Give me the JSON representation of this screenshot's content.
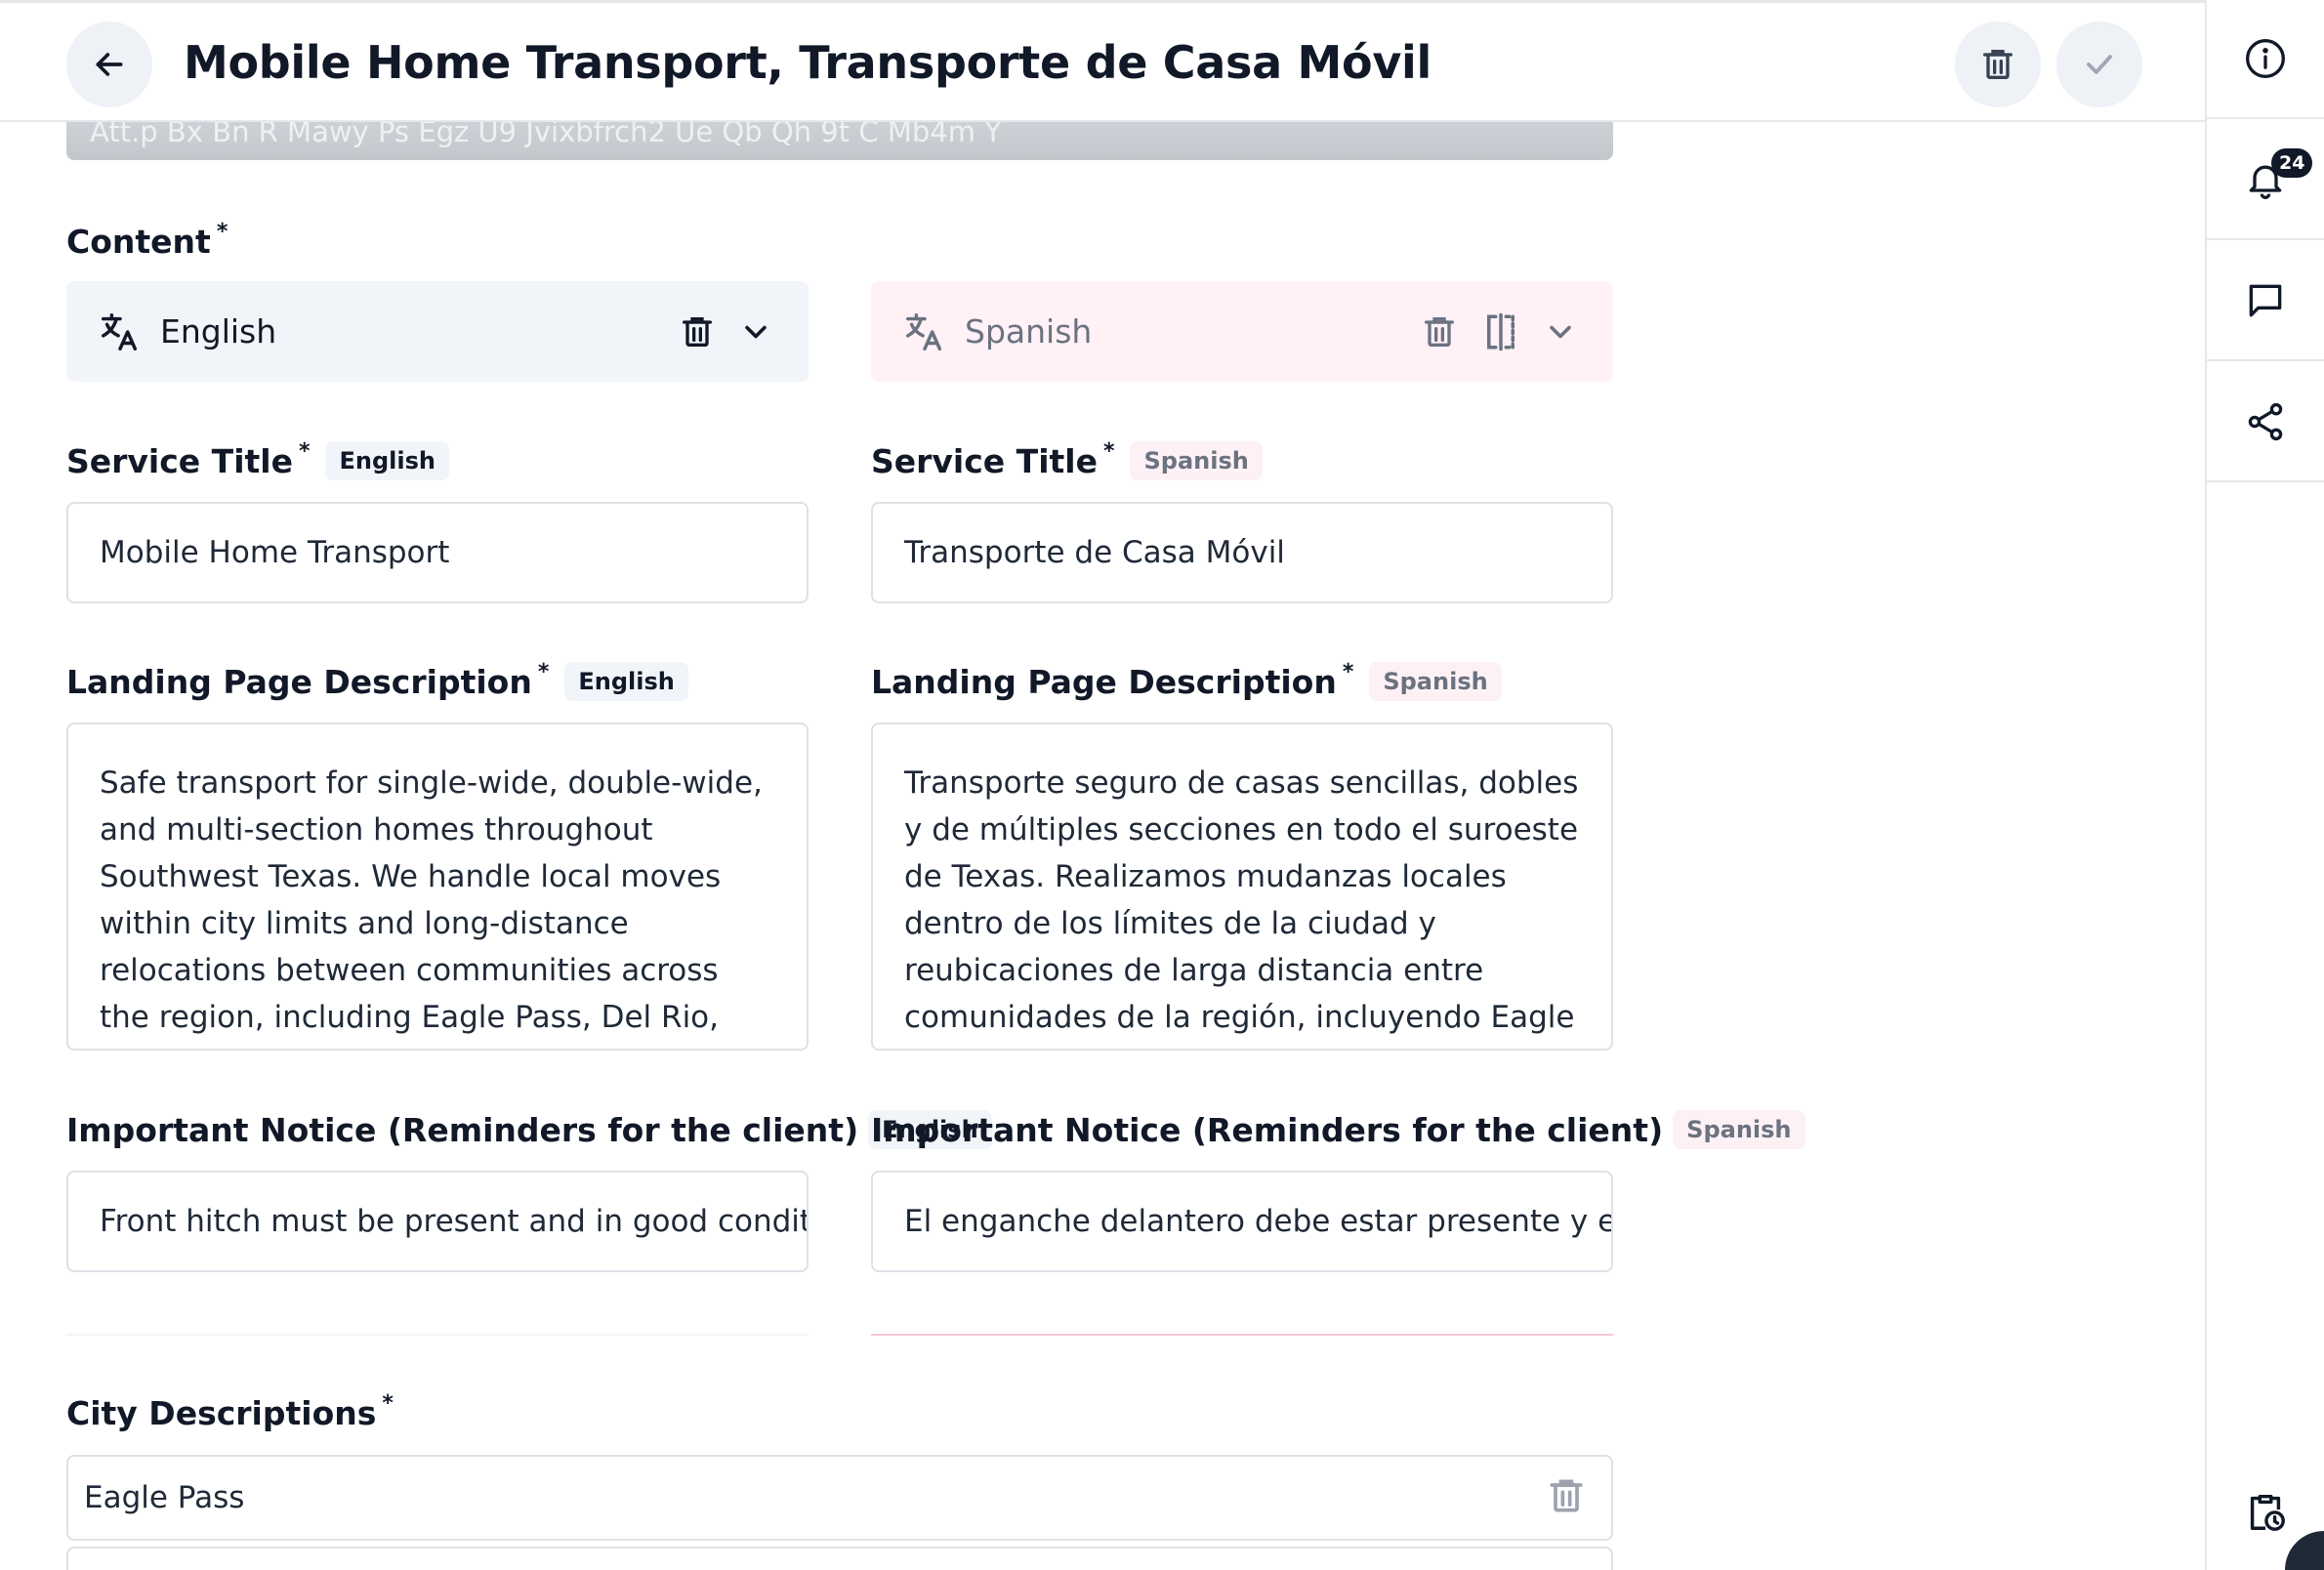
{
  "header": {
    "title": "Mobile Home Transport, Transporte de Casa Móvil"
  },
  "scrolled_field": {
    "value": "Att.p Bx Bn R Mawy Ps Egz U9 Jvixbfrch2 Ue Qb Qh 9t C Mb4m Y"
  },
  "content": {
    "label": "Content",
    "languages": [
      {
        "name": "English"
      },
      {
        "name": "Spanish"
      }
    ]
  },
  "fields": {
    "service_title": {
      "label": "Service Title",
      "en_tag": "English",
      "es_tag": "Spanish",
      "en_value": "Mobile Home Transport",
      "es_value": "Transporte de Casa Móvil"
    },
    "landing_description": {
      "label": "Landing Page Description",
      "en_tag": "English",
      "es_tag": "Spanish",
      "en_value": "Safe transport for single-wide, double-wide, and multi-section homes throughout Southwest Texas. We handle local moves within city limits and long-distance relocations between communities across the region, including Eagle Pass, Del Rio, Uvalde, San Antonio, Cotulla,",
      "es_value": "Transporte seguro de casas sencillas, dobles y de múltiples secciones en todo el suroeste de Texas. Realizamos mudanzas locales dentro de los límites de la ciudad y reubicaciones de larga distancia entre comunidades de la región, incluyendo Eagle Pass, Del Rio, Uvalde, San"
    },
    "important_notice": {
      "label": "Important Notice (Reminders for the client)",
      "en_tag": "English",
      "es_tag": "Spanish",
      "en_value": "Front hitch must be present and in good conditic",
      "es_value": "El enganche delantero debe estar presente y en"
    }
  },
  "city_descriptions": {
    "label": "City Descriptions",
    "items": [
      "Eagle Pass"
    ]
  },
  "rail": {
    "notification_count": "24"
  },
  "icons": {
    "back": "arrow-left-icon",
    "delete": "trash-icon",
    "confirm": "check-icon",
    "info": "info-icon",
    "notifications": "bell-icon",
    "comments": "chat-icon",
    "share": "share-icon",
    "schedule": "clipboard-clock-icon",
    "translate": "translate-icon",
    "chevron": "chevron-down-icon",
    "split": "split-view-icon"
  }
}
